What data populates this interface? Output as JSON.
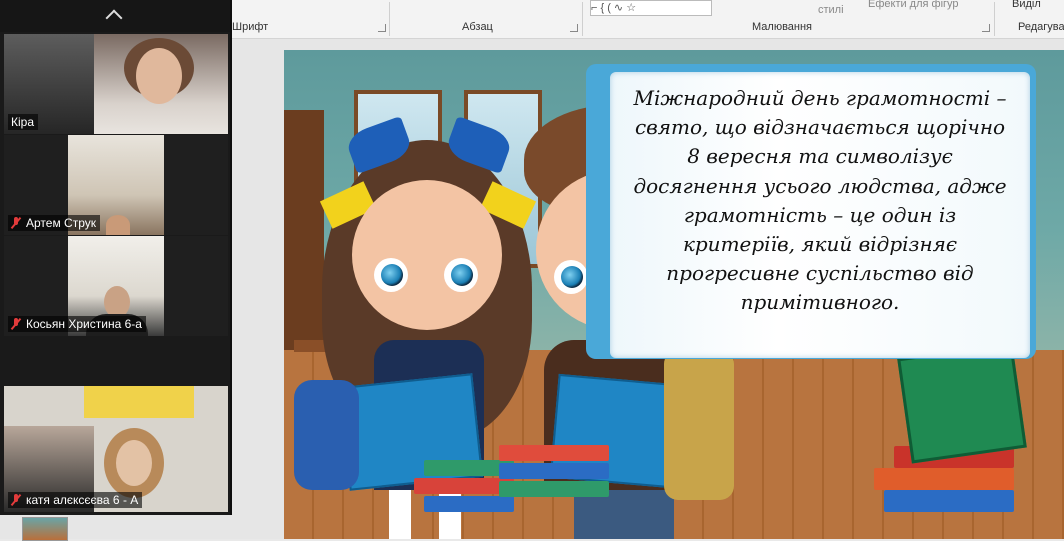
{
  "ribbon": {
    "groups": [
      "Шрифт",
      "Абзац",
      "Малювання",
      "Редагува"
    ],
    "top_items": [
      "стилі",
      "Ефекти для фігур",
      "Виділ"
    ]
  },
  "slide": {
    "text": "Міжнародний день грамотності – свято, що відзначається щорічно 8 вересня та символізує досягнення усього людства, адже грамотність – це один із критеріїв, який відрізняє прогресивне суспільство від примітивного."
  },
  "zoom": {
    "participants": [
      {
        "name": "Кіра",
        "muted": false
      },
      {
        "name": "Артем Струк",
        "muted": true
      },
      {
        "name": "Косьян Христина 6-а",
        "muted": true
      },
      {
        "name": "катя алєксєєва 6 - А",
        "muted": true
      }
    ]
  },
  "colors": {
    "book_cover": "#4aa8d8",
    "mute_red": "#e23b3b",
    "zoom_bg": "#1a1a1a"
  }
}
